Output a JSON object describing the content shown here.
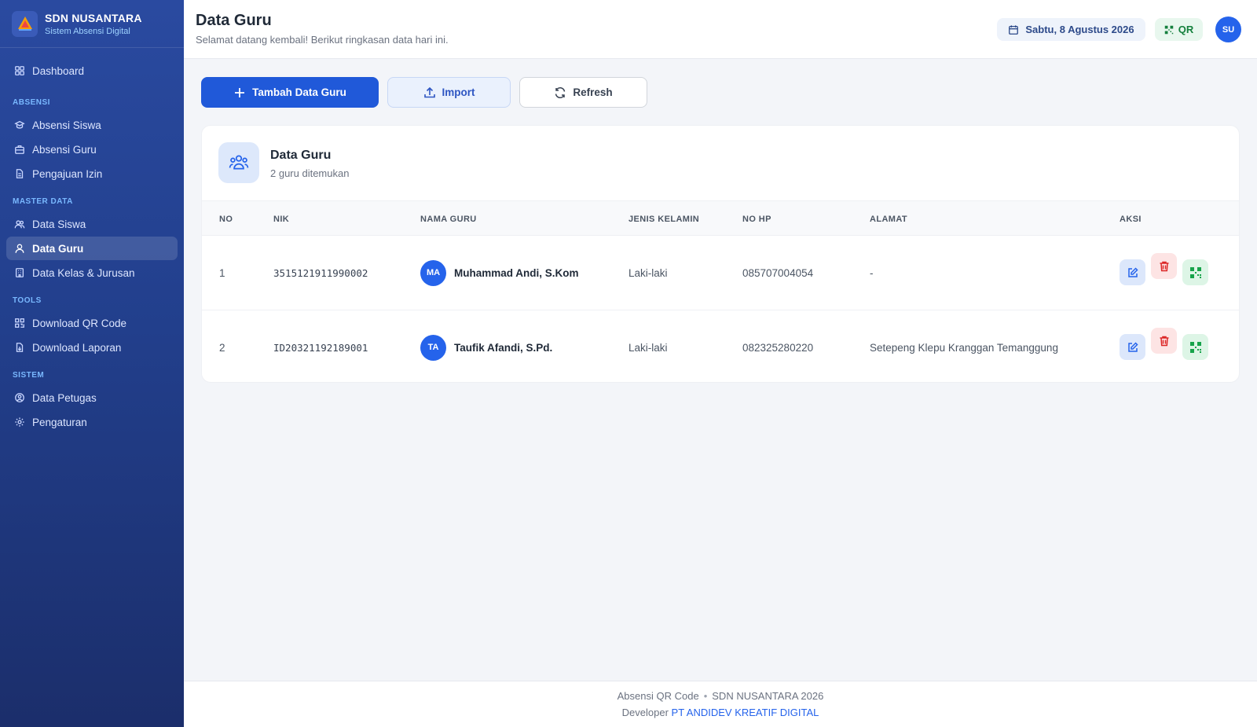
{
  "brand": {
    "name": "SDN NUSANTARA",
    "subtitle": "Sistem Absensi Digital"
  },
  "sidebar": {
    "dashboard": "Dashboard",
    "sections": [
      {
        "title": "ABSENSI",
        "items": [
          "Absensi Siswa",
          "Absensi Guru",
          "Pengajuan Izin"
        ]
      },
      {
        "title": "MASTER DATA",
        "items": [
          "Data Siswa",
          "Data Guru",
          "Data Kelas & Jurusan"
        ]
      },
      {
        "title": "TOOLS",
        "items": [
          "Download QR Code",
          "Download Laporan"
        ]
      },
      {
        "title": "SISTEM",
        "items": [
          "Data Petugas",
          "Pengaturan"
        ]
      }
    ],
    "active_item": "Data Guru"
  },
  "header": {
    "title": "Data Guru",
    "subtitle": "Selamat datang kembali! Berikut ringkasan data hari ini.",
    "date": "Sabtu, 8 Agustus 2026",
    "qr_label": "QR",
    "avatar_initials": "SU"
  },
  "toolbar": {
    "add_label": "Tambah Data Guru",
    "import_label": "Import",
    "refresh_label": "Refresh"
  },
  "card": {
    "title": "Data Guru",
    "subtitle": "2 guru ditemukan",
    "columns": [
      "NO",
      "NIK",
      "NAMA GURU",
      "JENIS KELAMIN",
      "NO HP",
      "ALAMAT",
      "AKSI"
    ],
    "rows": [
      {
        "no": "1",
        "nik": "3515121911990002",
        "initials": "MA",
        "name": "Muhammad Andi, S.Kom",
        "gender": "Laki-laki",
        "phone": "085707004054",
        "address": "-"
      },
      {
        "no": "2",
        "nik": "ID20321192189001",
        "initials": "TA",
        "name": "Taufik Afandi, S.Pd.",
        "gender": "Laki-laki",
        "phone": "082325280220",
        "address": "Setepeng Klepu Kranggan Temanggung"
      }
    ]
  },
  "footer": {
    "app": "Absensi QR Code",
    "school": "SDN NUSANTARA 2026",
    "dev_prefix": "Developer",
    "dev_name": "PT ANDIDEV KREATIF DIGITAL"
  },
  "colors": {
    "primary": "#2059d9",
    "sidebar": "#223f8c",
    "success": "#15803d",
    "danger": "#dc2626"
  }
}
